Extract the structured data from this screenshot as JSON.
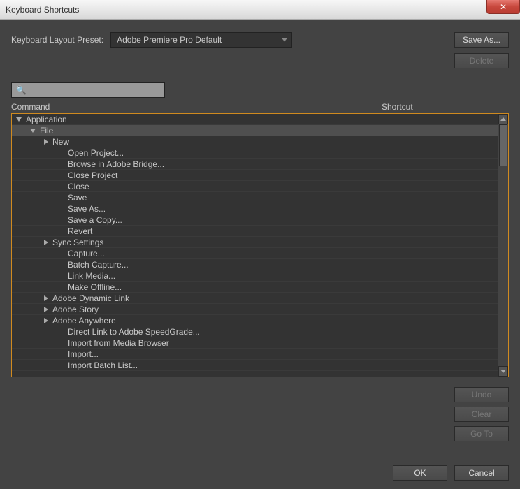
{
  "titlebar": {
    "title": "Keyboard Shortcuts"
  },
  "preset": {
    "label": "Keyboard Layout Preset:",
    "selected": "Adobe Premiere Pro Default"
  },
  "buttons": {
    "saveAs": "Save As...",
    "delete": "Delete",
    "undo": "Undo",
    "clear": "Clear",
    "goTo": "Go To",
    "ok": "OK",
    "cancel": "Cancel"
  },
  "search": {
    "placeholder": ""
  },
  "columns": {
    "command": "Command",
    "shortcut": "Shortcut"
  },
  "tree": [
    {
      "label": "Application",
      "indent": 0,
      "arrow": "down",
      "selected": false
    },
    {
      "label": "File",
      "indent": 1,
      "arrow": "down",
      "selected": true
    },
    {
      "label": "New",
      "indent": 2,
      "arrow": "right",
      "selected": false
    },
    {
      "label": "Open Project...",
      "indent": 3,
      "arrow": "none",
      "selected": false
    },
    {
      "label": "Browse in Adobe Bridge...",
      "indent": 3,
      "arrow": "none",
      "selected": false
    },
    {
      "label": "Close Project",
      "indent": 3,
      "arrow": "none",
      "selected": false
    },
    {
      "label": "Close",
      "indent": 3,
      "arrow": "none",
      "selected": false
    },
    {
      "label": "Save",
      "indent": 3,
      "arrow": "none",
      "selected": false
    },
    {
      "label": "Save As...",
      "indent": 3,
      "arrow": "none",
      "selected": false
    },
    {
      "label": "Save a Copy...",
      "indent": 3,
      "arrow": "none",
      "selected": false
    },
    {
      "label": "Revert",
      "indent": 3,
      "arrow": "none",
      "selected": false
    },
    {
      "label": "Sync Settings",
      "indent": 2,
      "arrow": "right",
      "selected": false
    },
    {
      "label": "Capture...",
      "indent": 3,
      "arrow": "none",
      "selected": false
    },
    {
      "label": "Batch Capture...",
      "indent": 3,
      "arrow": "none",
      "selected": false
    },
    {
      "label": "Link Media...",
      "indent": 3,
      "arrow": "none",
      "selected": false
    },
    {
      "label": "Make Offline...",
      "indent": 3,
      "arrow": "none",
      "selected": false
    },
    {
      "label": "Adobe Dynamic Link",
      "indent": 2,
      "arrow": "right",
      "selected": false
    },
    {
      "label": "Adobe Story",
      "indent": 2,
      "arrow": "right",
      "selected": false
    },
    {
      "label": "Adobe Anywhere",
      "indent": 2,
      "arrow": "right",
      "selected": false
    },
    {
      "label": "Direct Link to Adobe SpeedGrade...",
      "indent": 3,
      "arrow": "none",
      "selected": false
    },
    {
      "label": "Import from Media Browser",
      "indent": 3,
      "arrow": "none",
      "selected": false
    },
    {
      "label": "Import...",
      "indent": 3,
      "arrow": "none",
      "selected": false
    },
    {
      "label": "Import Batch List...",
      "indent": 3,
      "arrow": "none",
      "selected": false
    }
  ]
}
